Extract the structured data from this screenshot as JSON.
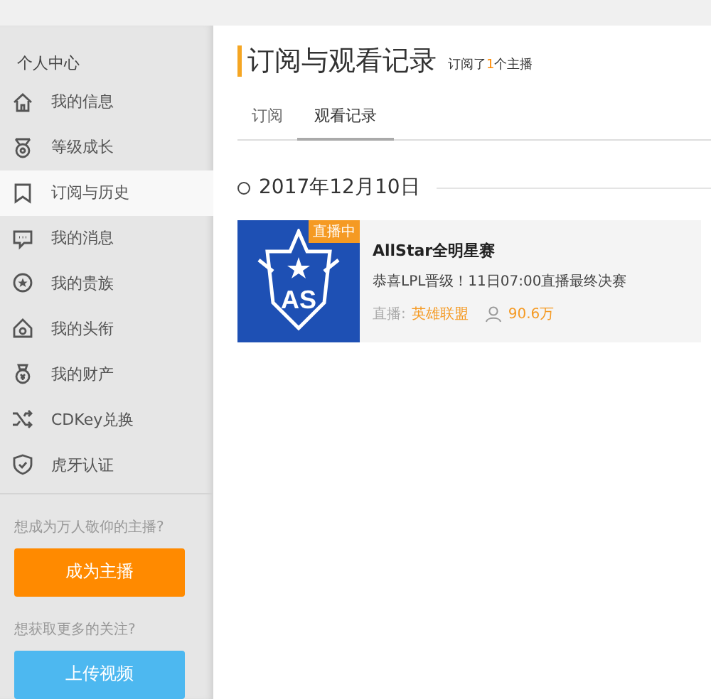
{
  "sidebar": {
    "heading": "个人中心",
    "items": [
      {
        "label": "我的信息",
        "selected": false
      },
      {
        "label": "等级成长",
        "selected": false
      },
      {
        "label": "订阅与历史",
        "selected": true
      },
      {
        "label": "我的消息",
        "selected": false
      },
      {
        "label": "我的贵族",
        "selected": false
      },
      {
        "label": "我的头衔",
        "selected": false
      },
      {
        "label": "我的财产",
        "selected": false
      },
      {
        "label": "CDKey兑换",
        "selected": false
      },
      {
        "label": "虎牙认证",
        "selected": false
      }
    ],
    "promos": [
      {
        "question": "想成为万人敬仰的主播?",
        "button": "成为主播",
        "color": "#ff8a00"
      },
      {
        "question": "想获取更多的关注?",
        "button": "上传视频",
        "color": "#4db8f0"
      }
    ]
  },
  "page": {
    "title": "订阅与观看记录",
    "subtitle": "订阅了**1**个主播"
  },
  "tabs": [
    {
      "label": "订阅",
      "selected": false
    },
    {
      "label": "观看记录",
      "selected": true
    }
  ],
  "history": [
    {
      "date": "2017年12月10日",
      "entries": [
        {
          "badge": "直播中",
          "logo_text": "AS",
          "title": "AllStar全明星赛",
          "description": "恭喜LPL晋级！11日07:00直播最终决赛",
          "category_label": "直播:",
          "category": "英雄联盟",
          "viewers": "90.6万"
        }
      ]
    }
  ]
}
